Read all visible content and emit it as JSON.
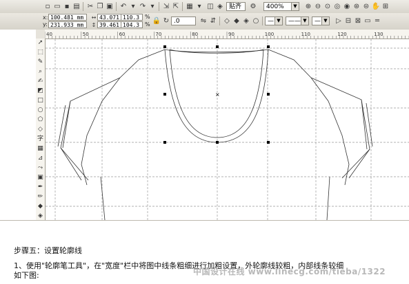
{
  "toolbar": {
    "zoom_value": "400%",
    "snap_label": "贴齐",
    "angle_value": ".0"
  },
  "properties": {
    "x_label": "x:",
    "x_value": "100.481 mm",
    "y_label": "y:",
    "y_value": "231.933 mm",
    "w_value": "43.071 mm",
    "h_value": "39.461 mm",
    "scale_x": "110.3",
    "scale_y": "104.3",
    "percent": "%"
  },
  "ruler": {
    "h_ticks": [
      "40",
      "50",
      "60",
      "70",
      "80",
      "90",
      "100",
      "110",
      "120",
      "130"
    ],
    "v_ticks": [
      "280",
      "270",
      "260",
      "250",
      "240",
      "230",
      "220",
      "210"
    ]
  },
  "tutorial": {
    "step_title": "步骤五：设置轮廓线",
    "step_body_line1": "1、使用\"轮廓笔工具\"，在\"宽度\"栏中将图中线条粗细进行加粗设置，外轮廓线较粗，内部线条较细",
    "step_body_line2": "如下图:",
    "watermark": "中国设计在线 www.linecg.com/tieba/1322"
  },
  "icons": {
    "new": "new-document-icon",
    "open": "open-icon",
    "save": "save-icon",
    "print": "print-icon",
    "cut": "cut-icon",
    "copy": "copy-icon",
    "paste": "paste-icon",
    "undo": "undo-icon",
    "redo": "redo-icon",
    "import": "import-icon",
    "export": "export-icon",
    "zoom": "zoom-icon"
  },
  "accent_color": "#000000"
}
